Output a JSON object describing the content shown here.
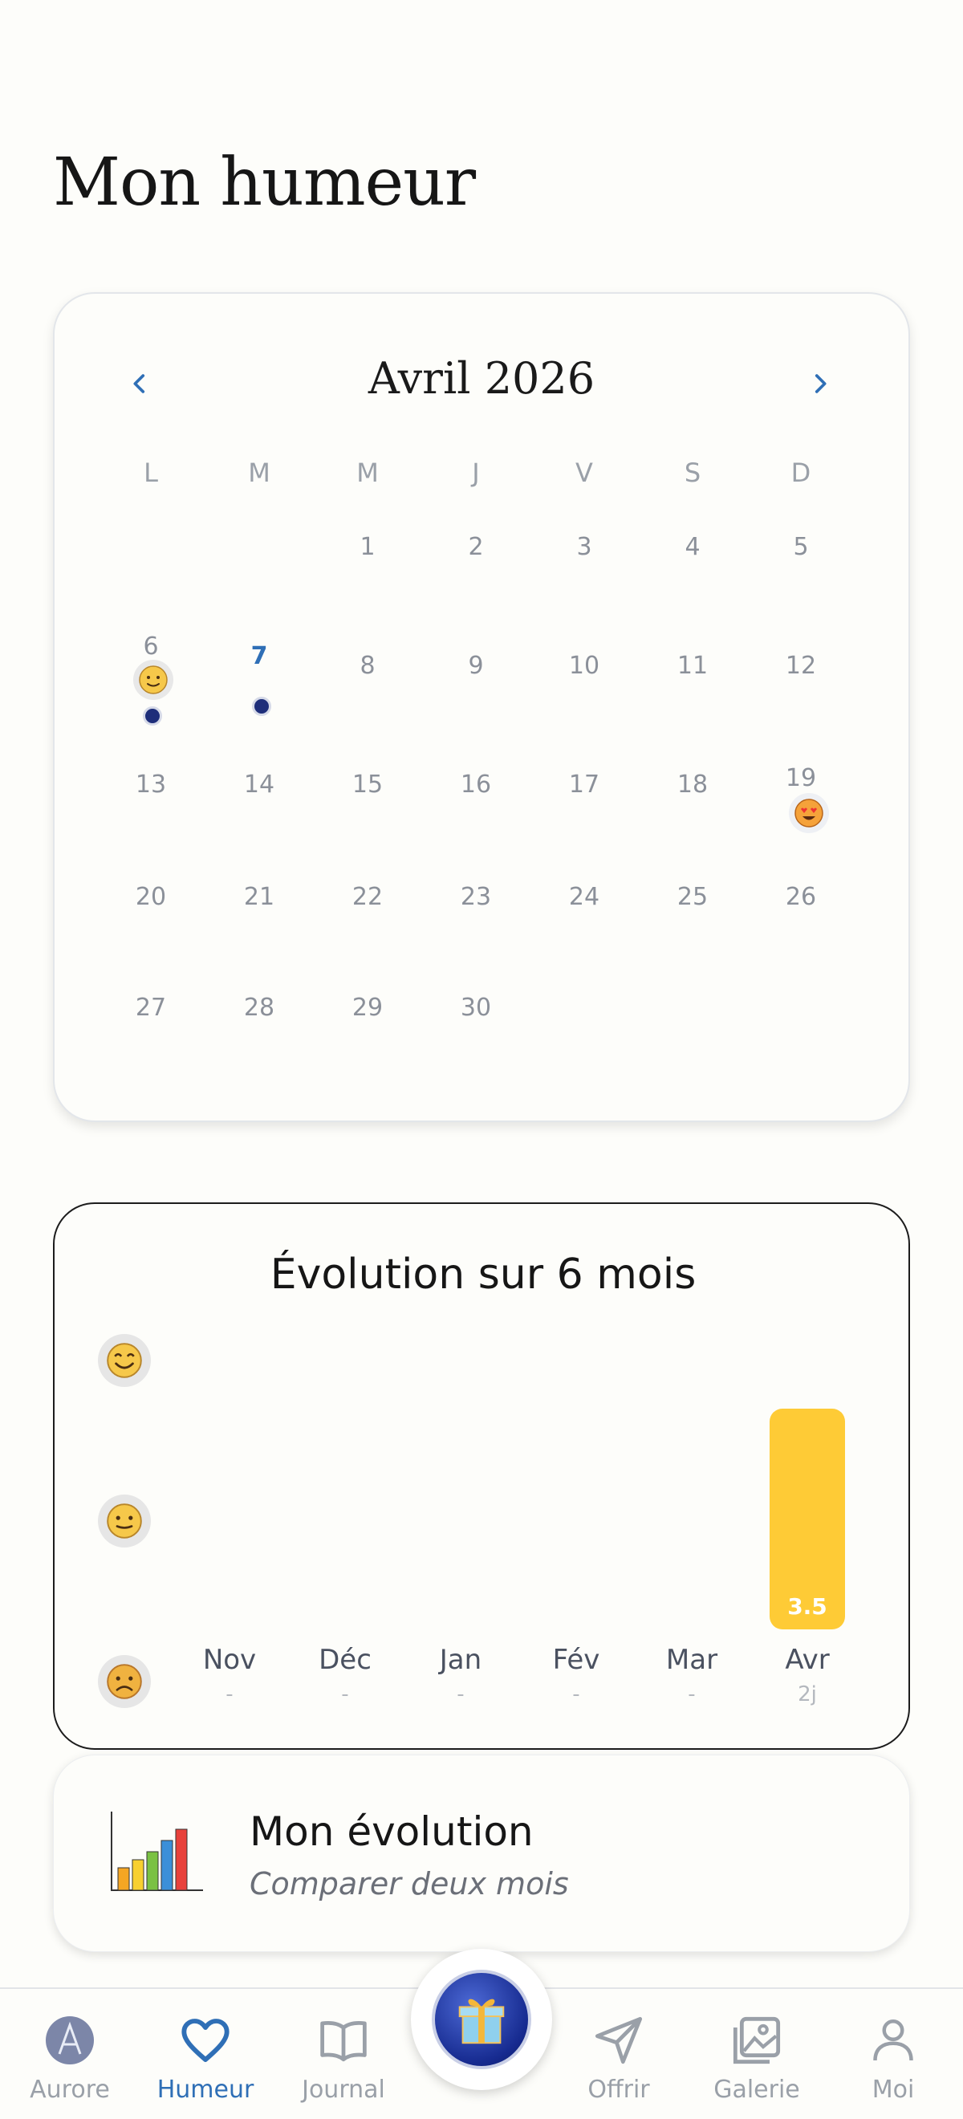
{
  "page": {
    "title": "Mon humeur"
  },
  "calendar": {
    "month_title": "Avril 2026",
    "weekdays": [
      "L",
      "M",
      "M",
      "J",
      "V",
      "S",
      "D"
    ],
    "days": [
      "1",
      "2",
      "3",
      "4",
      "5",
      "6",
      "7",
      "8",
      "9",
      "10",
      "11",
      "12",
      "13",
      "14",
      "15",
      "16",
      "17",
      "18",
      "19",
      "20",
      "21",
      "22",
      "23",
      "24",
      "25",
      "26",
      "27",
      "28",
      "29",
      "30"
    ],
    "today": "7",
    "moods": [
      {
        "day": "6",
        "mood": "neutral-smile-icon",
        "gift": true
      },
      {
        "day": "7",
        "gift": true
      },
      {
        "day": "19",
        "mood": "heart-eyes-icon"
      }
    ]
  },
  "chart_card": {
    "title": "Évolution sur 6 mois"
  },
  "chart_data": {
    "type": "bar",
    "title": "Évolution sur 6 mois",
    "categories": [
      "Nov",
      "Déc",
      "Jan",
      "Fév",
      "Mar",
      "Avr"
    ],
    "sublabels": [
      "-",
      "-",
      "-",
      "-",
      "-",
      "2j"
    ],
    "values": [
      null,
      null,
      null,
      null,
      null,
      3.5
    ],
    "value_labels": [
      "",
      "",
      "",
      "",
      "",
      "3.5"
    ],
    "y_icons": [
      "happy-face-icon",
      "neutral-face-icon",
      "sad-face-icon"
    ],
    "ylim": [
      1,
      5
    ],
    "color": "#fecb36"
  },
  "evolution": {
    "title": "Mon évolution",
    "subtitle": "Comparer deux mois"
  },
  "tabbar": {
    "items": [
      {
        "label": "Aurore",
        "icon": "aurore-logo-icon"
      },
      {
        "label": "Humeur",
        "icon": "heart-icon",
        "active": true
      },
      {
        "label": "Journal",
        "icon": "book-icon"
      },
      {
        "label": "Offrir",
        "icon": "send-icon"
      },
      {
        "label": "Galerie",
        "icon": "gallery-icon"
      },
      {
        "label": "Moi",
        "icon": "user-icon"
      }
    ],
    "fab_icon": "gift-icon"
  },
  "colors": {
    "accent": "#2f6fb6",
    "bar": "#fecb36",
    "background": "#fdfdfa"
  }
}
